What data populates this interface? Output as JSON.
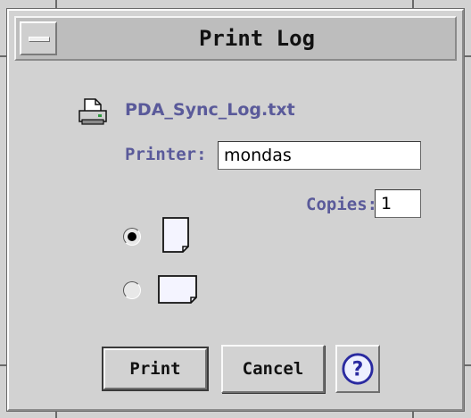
{
  "window": {
    "title": "Print Log"
  },
  "file": {
    "name": "PDA_Sync_Log.txt",
    "icon": "printer-icon"
  },
  "printer": {
    "label": "Printer:",
    "value": "mondas"
  },
  "copies": {
    "label": "Copies:",
    "value": "1"
  },
  "orientation": {
    "options": [
      {
        "name": "portrait",
        "selected": true,
        "icon": "portrait-page-icon"
      },
      {
        "name": "landscape",
        "selected": false,
        "icon": "landscape-page-icon"
      }
    ]
  },
  "buttons": {
    "print": "Print",
    "cancel": "Cancel",
    "help_icon": "help-icon"
  },
  "colors": {
    "label": "#5a5a9a",
    "background": "#d2d2d2",
    "help": "#2a2aa0"
  }
}
